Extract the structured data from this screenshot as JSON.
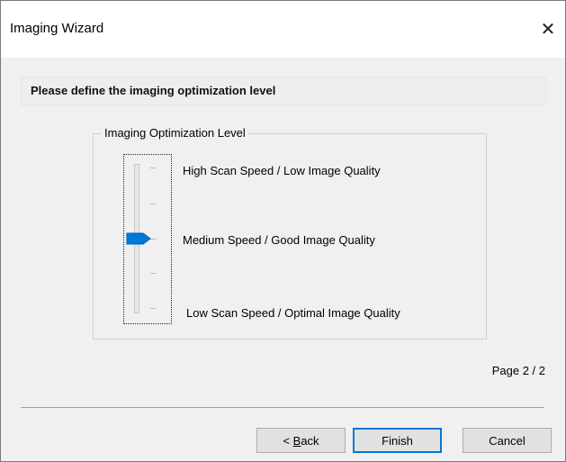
{
  "window": {
    "title": "Imaging Wizard",
    "close_glyph": "✕"
  },
  "header": {
    "text": "Please define the imaging optimization level"
  },
  "group": {
    "legend": "Imaging Optimization Level",
    "options": [
      "High Scan Speed / Low Image Quality",
      "Medium Speed / Good Image Quality",
      "Low Scan Speed / Optimal Image Quality"
    ],
    "selected_index": 1,
    "slider_thumb_color": "#0078d7"
  },
  "page_indicator": "Page 2 / 2",
  "buttons": {
    "back_prefix": "< ",
    "back_accel": "B",
    "back_rest": "ack",
    "finish": "Finish",
    "cancel": "Cancel"
  },
  "icons": {
    "close": "close-icon",
    "slider_thumb": "slider-thumb-icon"
  }
}
